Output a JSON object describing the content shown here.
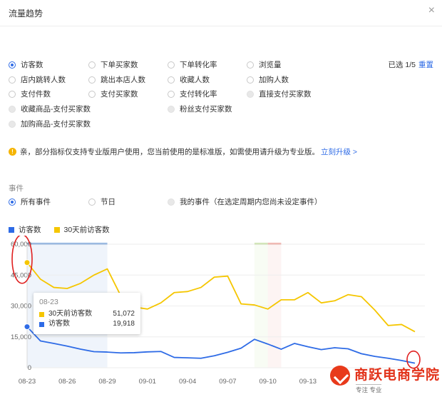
{
  "dialog": {
    "title": "流量趋势",
    "close": "×"
  },
  "metrics": {
    "row1": [
      "访客数",
      "下单买家数",
      "下单转化率",
      "浏览量"
    ],
    "row2": [
      "店内跳转人数",
      "跳出本店人数",
      "收藏人数",
      "加购人数"
    ],
    "row3": [
      "支付件数",
      "支付买家数",
      "支付转化率",
      "直接支付买家数"
    ],
    "row4": [
      "收藏商品-支付买家数",
      "粉丝支付买家数"
    ],
    "row5": [
      "加购商品-支付买家数"
    ]
  },
  "selection": {
    "label": "已选 1/5",
    "reset": "重置"
  },
  "notice": {
    "text": "亲，部分指标仅支持专业版用户使用，您当前使用的是标准版，如需使用请升级为专业版。",
    "upgrade": "立刻升级 >"
  },
  "events": {
    "label": "事件",
    "options": [
      "所有事件",
      "节日",
      "我的事件（在选定周期内您尚未设定事件）"
    ]
  },
  "legend": [
    {
      "name": "访客数",
      "color": "#2e6be6"
    },
    {
      "name": "30天前访客数",
      "color": "#f5c600"
    }
  ],
  "tooltip": {
    "date": "08-23",
    "rows": [
      {
        "name": "30天前访客数",
        "value": "51,072",
        "color": "#f5c600"
      },
      {
        "name": "访客数",
        "value": "19,918",
        "color": "#2e6be6"
      }
    ]
  },
  "chart_data": {
    "type": "line",
    "x": [
      "08-23",
      "08-24",
      "08-25",
      "08-26",
      "08-27",
      "08-28",
      "08-29",
      "08-30",
      "08-31",
      "09-01",
      "09-02",
      "09-03",
      "09-04",
      "09-05",
      "09-06",
      "09-07",
      "09-08",
      "09-09",
      "09-10",
      "09-11",
      "09-12",
      "09-13",
      "09-14",
      "09-15",
      "09-16",
      "09-17",
      "09-18",
      "09-19",
      "09-20",
      "09-21"
    ],
    "xticks": [
      "08-23",
      "08-26",
      "08-29",
      "09-01",
      "09-04",
      "09-07",
      "09-10",
      "09-13"
    ],
    "yticks": [
      "0",
      "15,000",
      "30,000",
      "45,000",
      "60,000"
    ],
    "ylim": [
      0,
      60000
    ],
    "series": [
      {
        "name": "访客数",
        "color": "#2e6be6",
        "values": [
          19918,
          13000,
          11800,
          10500,
          9000,
          7800,
          7600,
          7200,
          7300,
          7700,
          7900,
          5000,
          4800,
          4600,
          5800,
          7500,
          9500,
          13800,
          11500,
          9000,
          11800,
          10200,
          8800,
          9700,
          9200,
          6800,
          5500,
          4600,
          3500,
          2200
        ]
      },
      {
        "name": "30天前访客数",
        "color": "#f5c600",
        "values": [
          51072,
          43000,
          39000,
          38500,
          41000,
          45000,
          48000,
          35000,
          29500,
          28500,
          31500,
          36500,
          37000,
          39000,
          44000,
          44500,
          31000,
          30500,
          28500,
          33000,
          33000,
          36500,
          31500,
          32500,
          35500,
          34500,
          28000,
          20500,
          21000,
          17500
        ]
      }
    ],
    "highlight_ranges": [
      {
        "from": "08-23",
        "to": "08-29",
        "color": "#7fa8dc"
      },
      {
        "from": "09-09",
        "to": "09-10",
        "color": "#c9e3a8"
      },
      {
        "from": "09-10",
        "to": "09-11",
        "color": "#f0a8a0"
      }
    ],
    "tooltip_index": 0,
    "grid": true
  },
  "watermark": {
    "title": "商跃电商学院",
    "subtitle": "专注 专业"
  }
}
